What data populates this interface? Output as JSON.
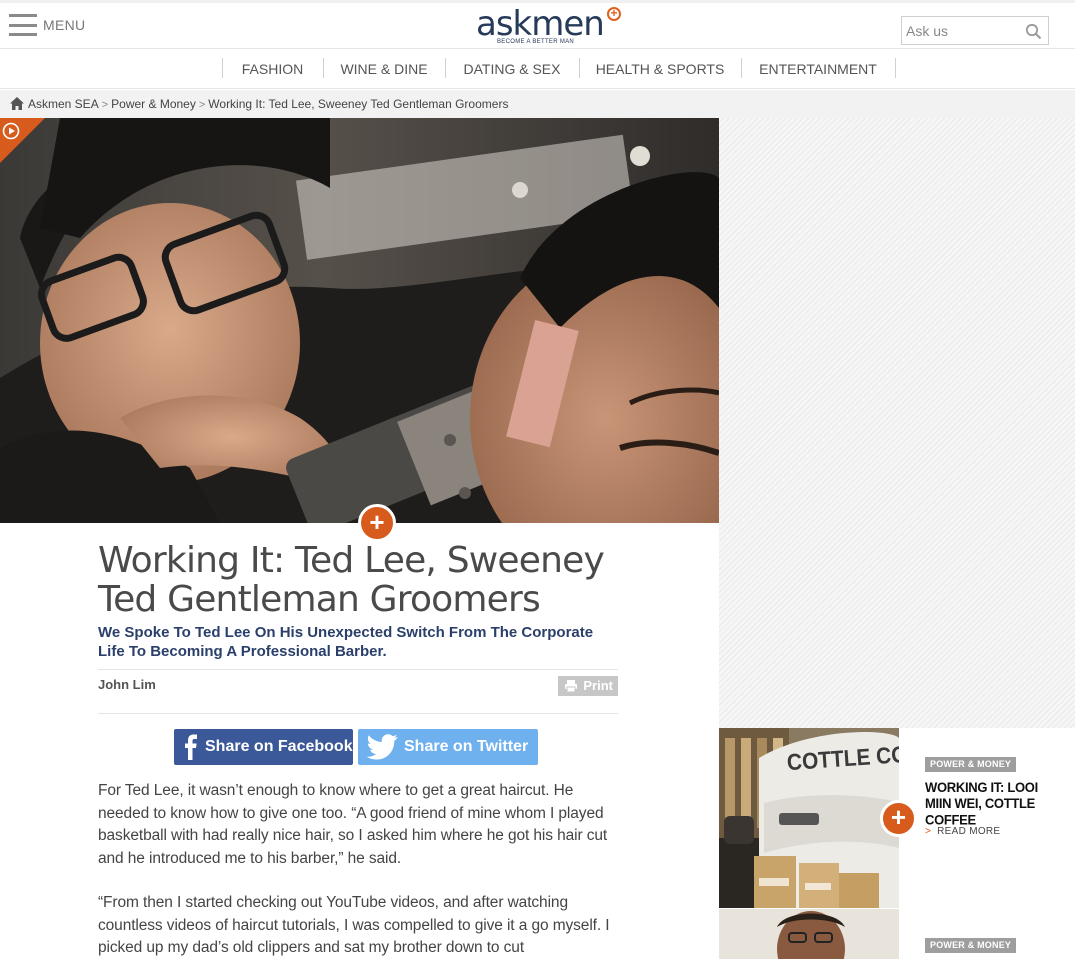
{
  "header": {
    "menu_label": "MENU",
    "logo": {
      "word": "askmen",
      "tagline": "BECOME A BETTER MAN"
    },
    "search": {
      "placeholder": "Ask us"
    }
  },
  "nav": {
    "items": [
      {
        "label": "FASHION"
      },
      {
        "label": "WINE & DINE"
      },
      {
        "label": "DATING & SEX"
      },
      {
        "label": "HEALTH & SPORTS"
      },
      {
        "label": "ENTERTAINMENT"
      }
    ]
  },
  "breadcrumb": {
    "items": [
      {
        "label": "Askmen SEA"
      },
      {
        "label": "Power & Money"
      },
      {
        "label": "Working It: Ted Lee, Sweeney Ted Gentleman Groomers"
      }
    ],
    "separator": ">"
  },
  "article": {
    "title": "Working It: Ted Lee, Sweeney Ted Gentleman Groomers",
    "subtitle": "We Spoke To Ted Lee On His Unexpected Switch From The Corporate Life To Becoming A Professional Barber.",
    "author": "John Lim",
    "print_label": "Print",
    "share_facebook": "Share on Facebook",
    "share_twitter": "Share on Twitter",
    "paragraphs": [
      "For Ted Lee, it wasn’t enough to know where to get a great haircut. He needed to know how to give one too. “A good friend of mine whom I played basketball with had really nice hair, so I asked him where he got his hair cut and he introduced me to his barber,” he said.",
      "“From then I started checking out YouTube videos, and after watching countless videos of haircut tutorials, I was compelled to give it a go myself. I picked up my dad’s old clippers and sat my brother down to cut"
    ]
  },
  "sidebar": {
    "cards": [
      {
        "category": "POWER & MONEY",
        "title": "WORKING IT: LOOI MIIN WEI, COTTLE COFFEE",
        "read_more": "READ MORE",
        "image_sign": "COTTLE COFF"
      },
      {
        "category": "POWER & MONEY"
      }
    ]
  },
  "colors": {
    "accent": "#d75b1c",
    "navy": "#2b3f6b",
    "facebook": "#3b5998",
    "twitter": "#6fb1ef"
  }
}
